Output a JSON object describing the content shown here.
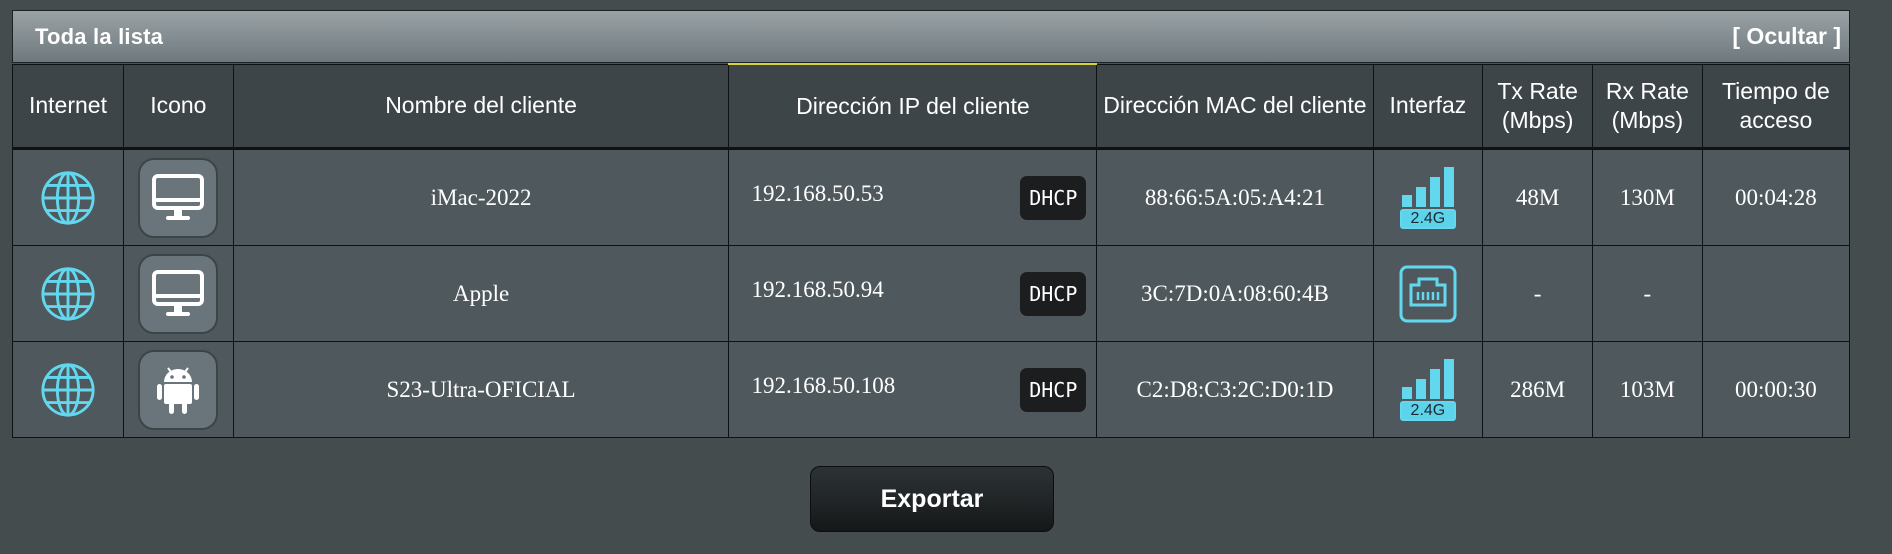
{
  "panel": {
    "title": "Toda la lista",
    "hide_label": "[ Ocultar ]"
  },
  "columns": [
    "Internet",
    "Icono",
    "Nombre del cliente",
    "Dirección IP del cliente",
    "Dirección MAC del cliente",
    "Interfaz",
    "Tx Rate (Mbps)",
    "Rx Rate (Mbps)",
    "Tiempo de acceso"
  ],
  "clients": [
    {
      "internet_icon": "globe-icon",
      "device_icon": "monitor-icon",
      "name": "iMac-2022",
      "ip": "192.168.50.53",
      "ip_type": "DHCP",
      "mac": "88:66:5A:05:A4:21",
      "interface_icon": "wifi-signal-icon",
      "band": "2.4G",
      "tx": "48M",
      "rx": "130M",
      "time": "00:04:28"
    },
    {
      "internet_icon": "globe-icon",
      "device_icon": "monitor-icon",
      "name": "Apple",
      "ip": "192.168.50.94",
      "ip_type": "DHCP",
      "mac": "3C:7D:0A:08:60:4B",
      "interface_icon": "ethernet-port-icon",
      "band": "",
      "tx": "-",
      "rx": "-",
      "time": ""
    },
    {
      "internet_icon": "globe-icon",
      "device_icon": "android-icon",
      "name": "S23-Ultra-OFICIAL",
      "ip": "192.168.50.108",
      "ip_type": "DHCP",
      "mac": "C2:D8:C3:2C:D0:1D",
      "interface_icon": "wifi-signal-icon",
      "band": "2.4G",
      "tx": "286M",
      "rx": "103M",
      "time": "00:00:30"
    }
  ],
  "export_label": "Exportar",
  "colors": {
    "accent": "#63d7ee",
    "sorted_indicator": "#d8d23a",
    "badge_bg": "#1b1d1e"
  }
}
